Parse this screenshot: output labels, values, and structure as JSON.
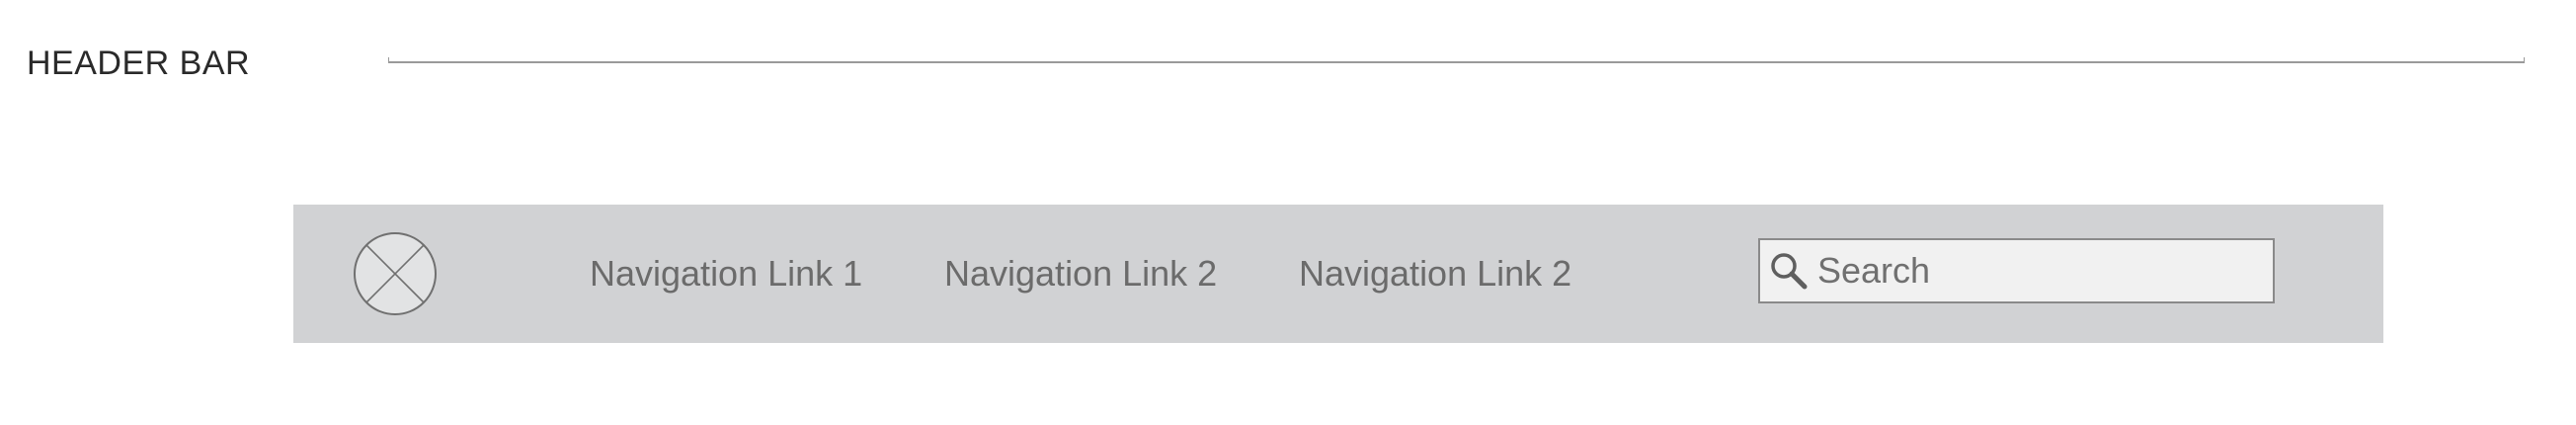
{
  "section": {
    "label": "HEADER BAR"
  },
  "navbar": {
    "logo_icon": "placeholder-image-icon",
    "links": [
      {
        "label": "Navigation Link 1"
      },
      {
        "label": "Navigation Link 2"
      },
      {
        "label": "Navigation Link 2"
      }
    ],
    "search": {
      "icon": "search-icon",
      "placeholder": "Search",
      "value": ""
    }
  },
  "colors": {
    "page_background": "#ffffff",
    "navbar_background": "#d1d2d4",
    "link_text": "#6b6b6b",
    "search_background": "#f1f1f1",
    "search_border": "#8a8a8a",
    "rule": "#9a9a9a"
  }
}
